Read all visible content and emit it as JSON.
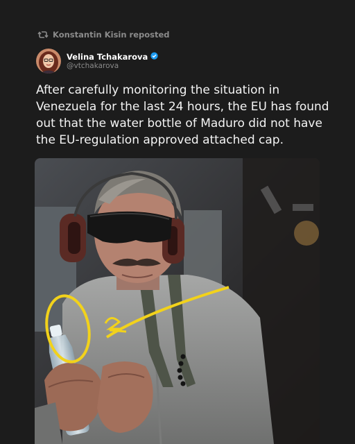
{
  "repost": {
    "icon": "repost-icon",
    "label": "Konstantin Kisin reposted"
  },
  "author": {
    "name": "Velina Tchakarova",
    "handle": "@vtchakarova",
    "verified_badge": "verified-badge-icon",
    "badge_color": "#1d9bf0"
  },
  "post": {
    "text": "After carefully monitoring the situation in Venezuela for the last 24 hours, the EU has found out that the water bottle of Maduro did not have the EU-regulation approved attached cap."
  },
  "photo": {
    "annotation_color": "#f2d21b"
  },
  "colors": {
    "background": "#1c1c1c",
    "text": "#f4f4f4",
    "muted": "#8b8b8b"
  }
}
